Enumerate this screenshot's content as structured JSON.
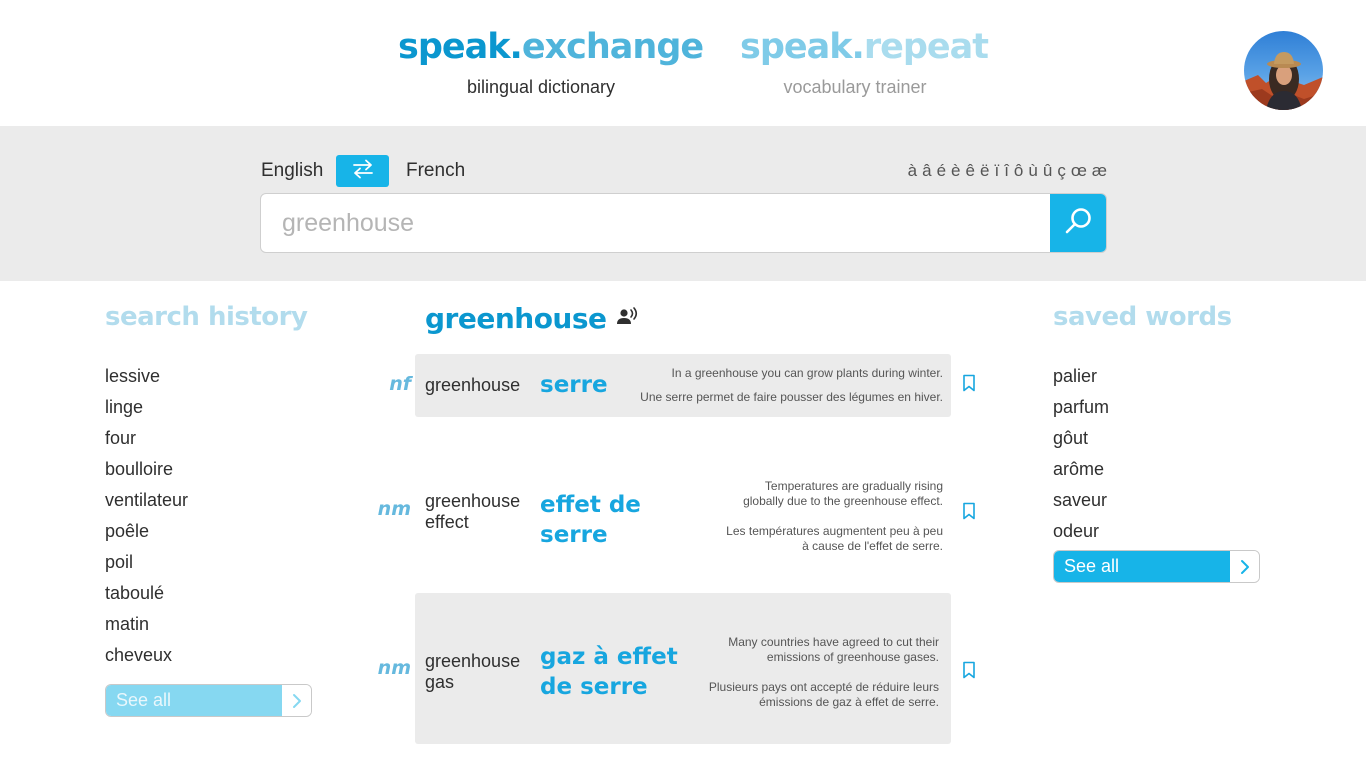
{
  "header": {
    "brand1": {
      "part1": "speak.",
      "part2": "exchange",
      "subtitle": "bilingual dictionary"
    },
    "brand2": {
      "part1": "speak.",
      "part2": "repeat",
      "subtitle": "vocabulary trainer"
    },
    "avatar": "user-avatar"
  },
  "search": {
    "lang_from": "English",
    "lang_to": "French",
    "placeholder": "greenhouse",
    "accents": [
      "à",
      "â",
      "é",
      "è",
      "ê",
      "ë",
      "ï",
      "î",
      "ô",
      "ù",
      "û",
      "ç",
      "œ",
      "æ"
    ],
    "swap_icon": "swap-arrows-icon",
    "search_icon": "magnifier-icon"
  },
  "history": {
    "title": "search history",
    "items": [
      "lessive",
      "linge",
      "four",
      "boulloire",
      "ventilateur",
      "poêle",
      "poil",
      "taboulé",
      "matin",
      "cheveux"
    ],
    "see_all": "See all"
  },
  "saved": {
    "title": "saved words",
    "items": [
      "palier",
      "parfum",
      "gôut",
      "arôme",
      "saveur",
      "odeur"
    ],
    "see_all": "See all"
  },
  "result": {
    "word": "greenhouse",
    "audio_icon": "speaker-person-icon",
    "entries": [
      {
        "pos": "nf",
        "source": "greenhouse",
        "target": "serre",
        "example_en": "In a greenhouse you can grow plants during winter.",
        "example_fr": "Une serre permet de faire pousser des légumes en hiver."
      },
      {
        "pos": "nm",
        "source": "greenhouse effect",
        "target": "effet de serre",
        "example_en": "Temperatures are gradually rising globally due to the greenhouse effect.",
        "example_fr": "Les températures augmentent peu à peu à cause de l'effet de serre."
      },
      {
        "pos": "nm",
        "source": "greenhouse gas",
        "target": "gaz à effet de serre",
        "example_en": "Many countries have agreed to cut their emissions of greenhouse gases.",
        "example_fr": "Plusieurs pays ont accepté de réduire leurs émissions de gaz à effet de serre."
      }
    ]
  },
  "colors": {
    "accent": "#17b4e8",
    "brand": "#0b97cf",
    "band": "#ebebeb"
  }
}
